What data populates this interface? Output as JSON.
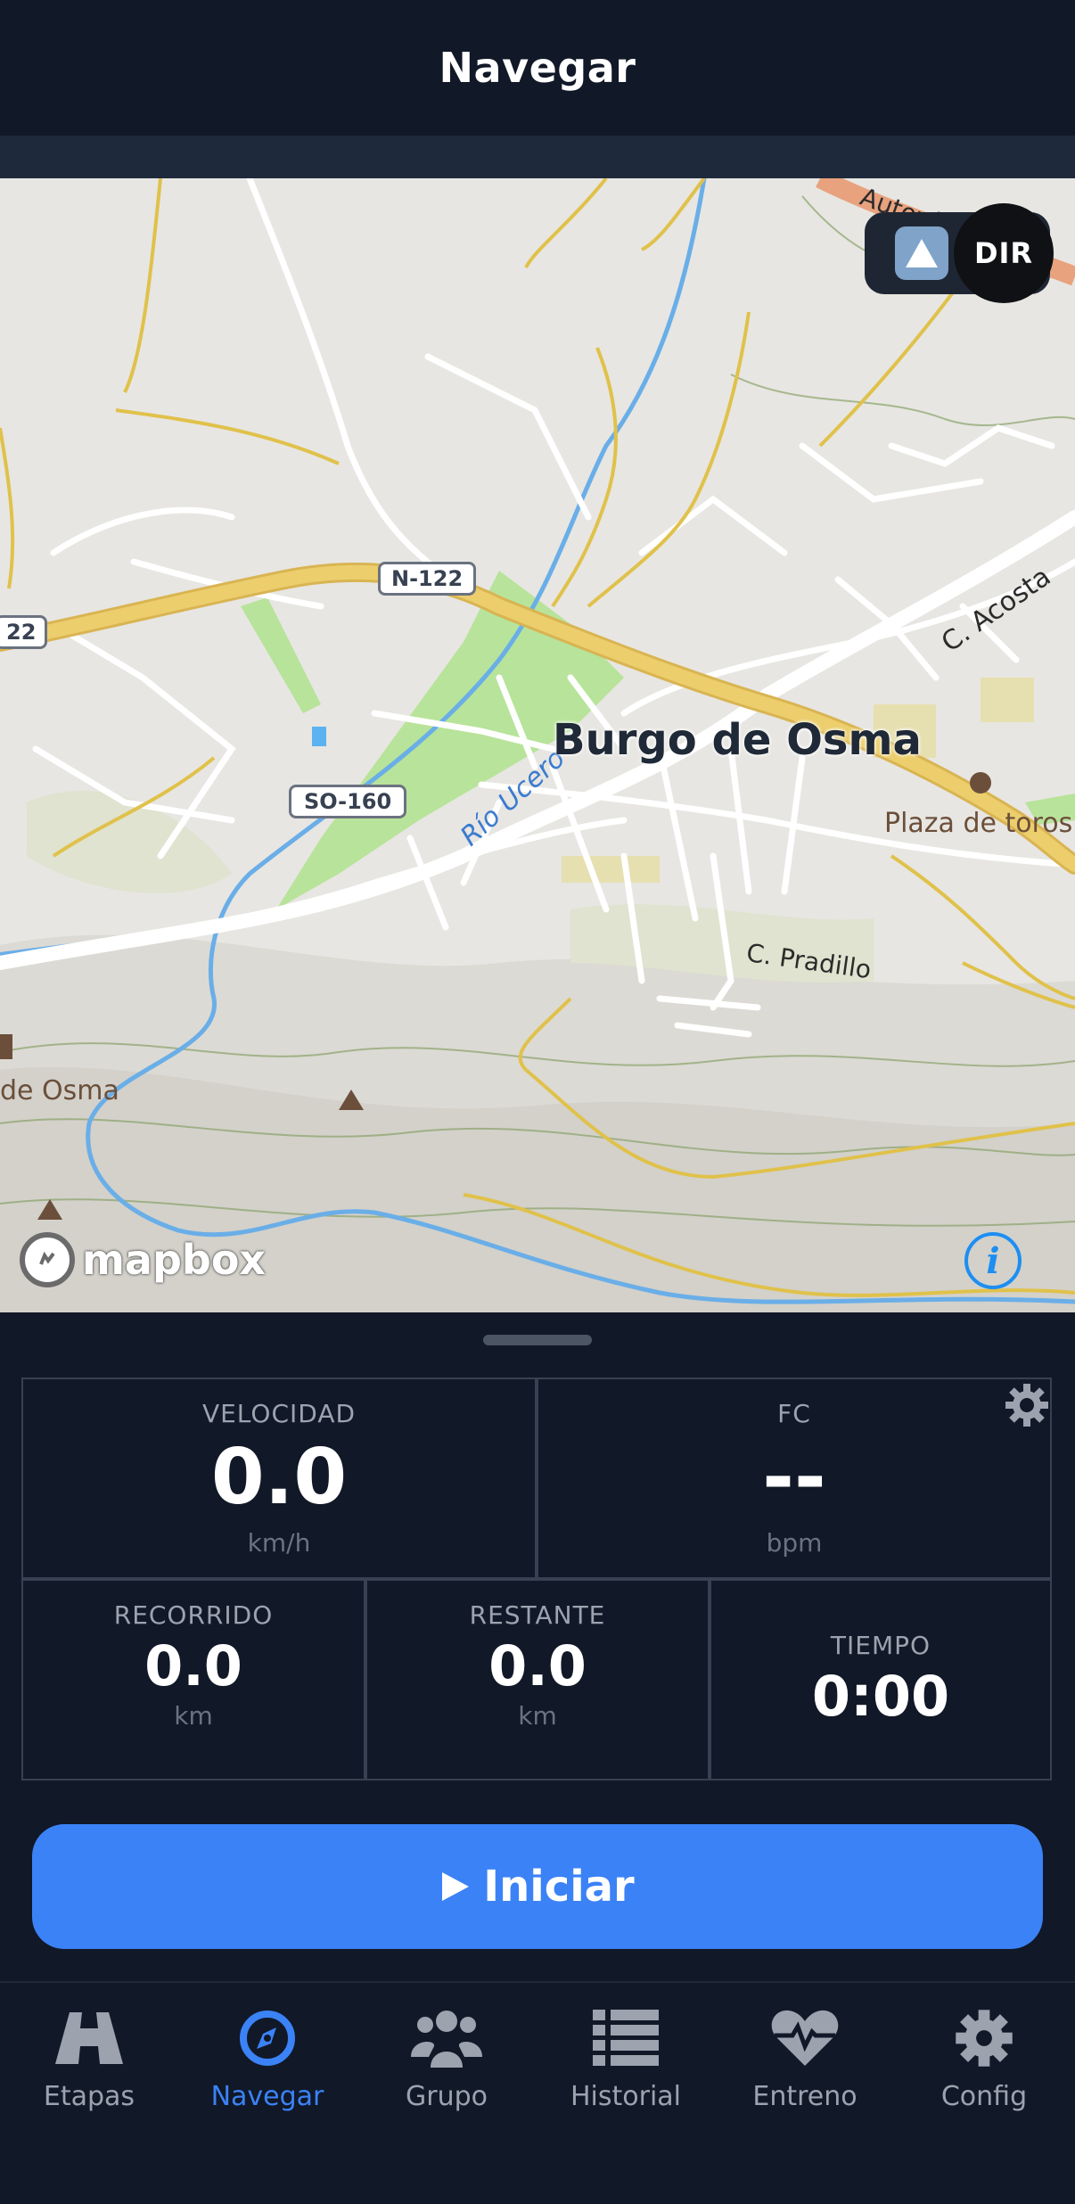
{
  "header": {
    "title": "Navegar"
  },
  "map": {
    "town_label": "Burgo de Osma",
    "labels": {
      "road_n122": "N-122",
      "road_n122_left": "22",
      "road_so160": "SO-160",
      "river": "Río Ucero",
      "street_acosta": "C. Acosta",
      "street_pradillo": "C. Pradillo",
      "plaza": "Plaza de toros",
      "left_place": "de Osma",
      "autovia": "Autovía"
    },
    "dir_button": "DIR",
    "attribution": "mapbox",
    "info_icon": "i"
  },
  "stats": {
    "speed": {
      "label": "VELOCIDAD",
      "value": "0.0",
      "unit": "km/h"
    },
    "hr": {
      "label": "FC",
      "value": "--",
      "unit": "bpm"
    },
    "distance": {
      "label": "RECORRIDO",
      "value": "0.0",
      "unit": "km"
    },
    "remaining": {
      "label": "RESTANTE",
      "value": "0.0",
      "unit": "km"
    },
    "time": {
      "label": "TIEMPO",
      "value": "0:00"
    }
  },
  "start_button": {
    "label": "Iniciar",
    "icon": "play-icon"
  },
  "tabs": [
    {
      "label": "Etapas",
      "icon": "road-icon",
      "active": false
    },
    {
      "label": "Navegar",
      "icon": "compass-icon",
      "active": true
    },
    {
      "label": "Grupo",
      "icon": "group-icon",
      "active": false
    },
    {
      "label": "Historial",
      "icon": "list-icon",
      "active": false
    },
    {
      "label": "Entreno",
      "icon": "heartbeat-icon",
      "active": false
    },
    {
      "label": "Config",
      "icon": "gear-icon",
      "active": false
    }
  ],
  "colors": {
    "accent": "#3b82f6",
    "background": "#111827",
    "map_bg": "#e7e6e2",
    "highway": "#e8c96b",
    "park": "#b8e39a",
    "water": "#6aaee8"
  }
}
